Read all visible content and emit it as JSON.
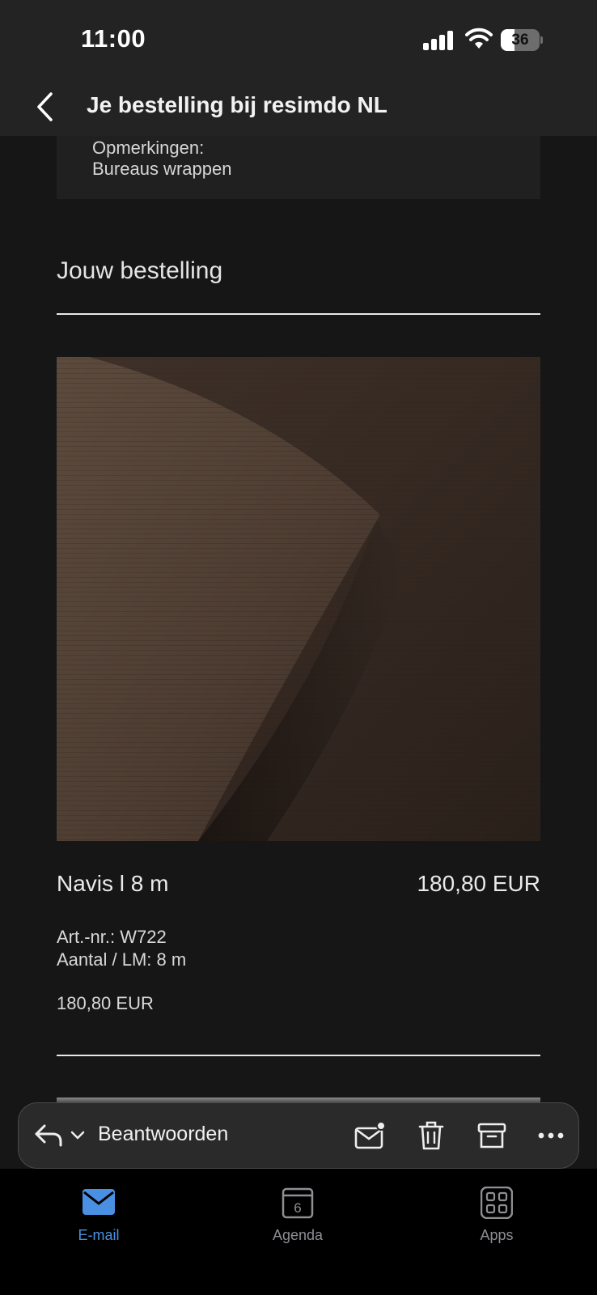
{
  "status_bar": {
    "time": "11:00",
    "battery_level": "36",
    "battery_fraction": 0.36
  },
  "nav": {
    "title": "Je bestelling bij resimdo NL"
  },
  "remarks": {
    "label": "Opmerkingen:",
    "value": "Bureaus wrappen"
  },
  "order": {
    "section_title": "Jouw bestelling",
    "item": {
      "name": "Navis l 8 m",
      "price": "180,80 EUR",
      "article_no": "Art.-nr.: W722",
      "quantity": "Aantal / LM: 8 m",
      "subtotal": "180,80 EUR",
      "image": "dark-brown-wood-foil-roll"
    }
  },
  "actions": {
    "reply_label": "Beantwoorden",
    "icons": [
      "reply-icon",
      "chevron-down-icon",
      "mark-unread-icon",
      "trash-icon",
      "archive-icon",
      "more-icon"
    ]
  },
  "tabs": [
    {
      "label": "E-mail",
      "icon": "mail-icon",
      "active": true
    },
    {
      "label": "Agenda",
      "icon": "calendar-icon",
      "day": "6",
      "active": false
    },
    {
      "label": "Apps",
      "icon": "apps-grid-icon",
      "active": false
    }
  ],
  "colors": {
    "background": "#161616",
    "accent": "#4a90e2",
    "bar": "#232323"
  }
}
